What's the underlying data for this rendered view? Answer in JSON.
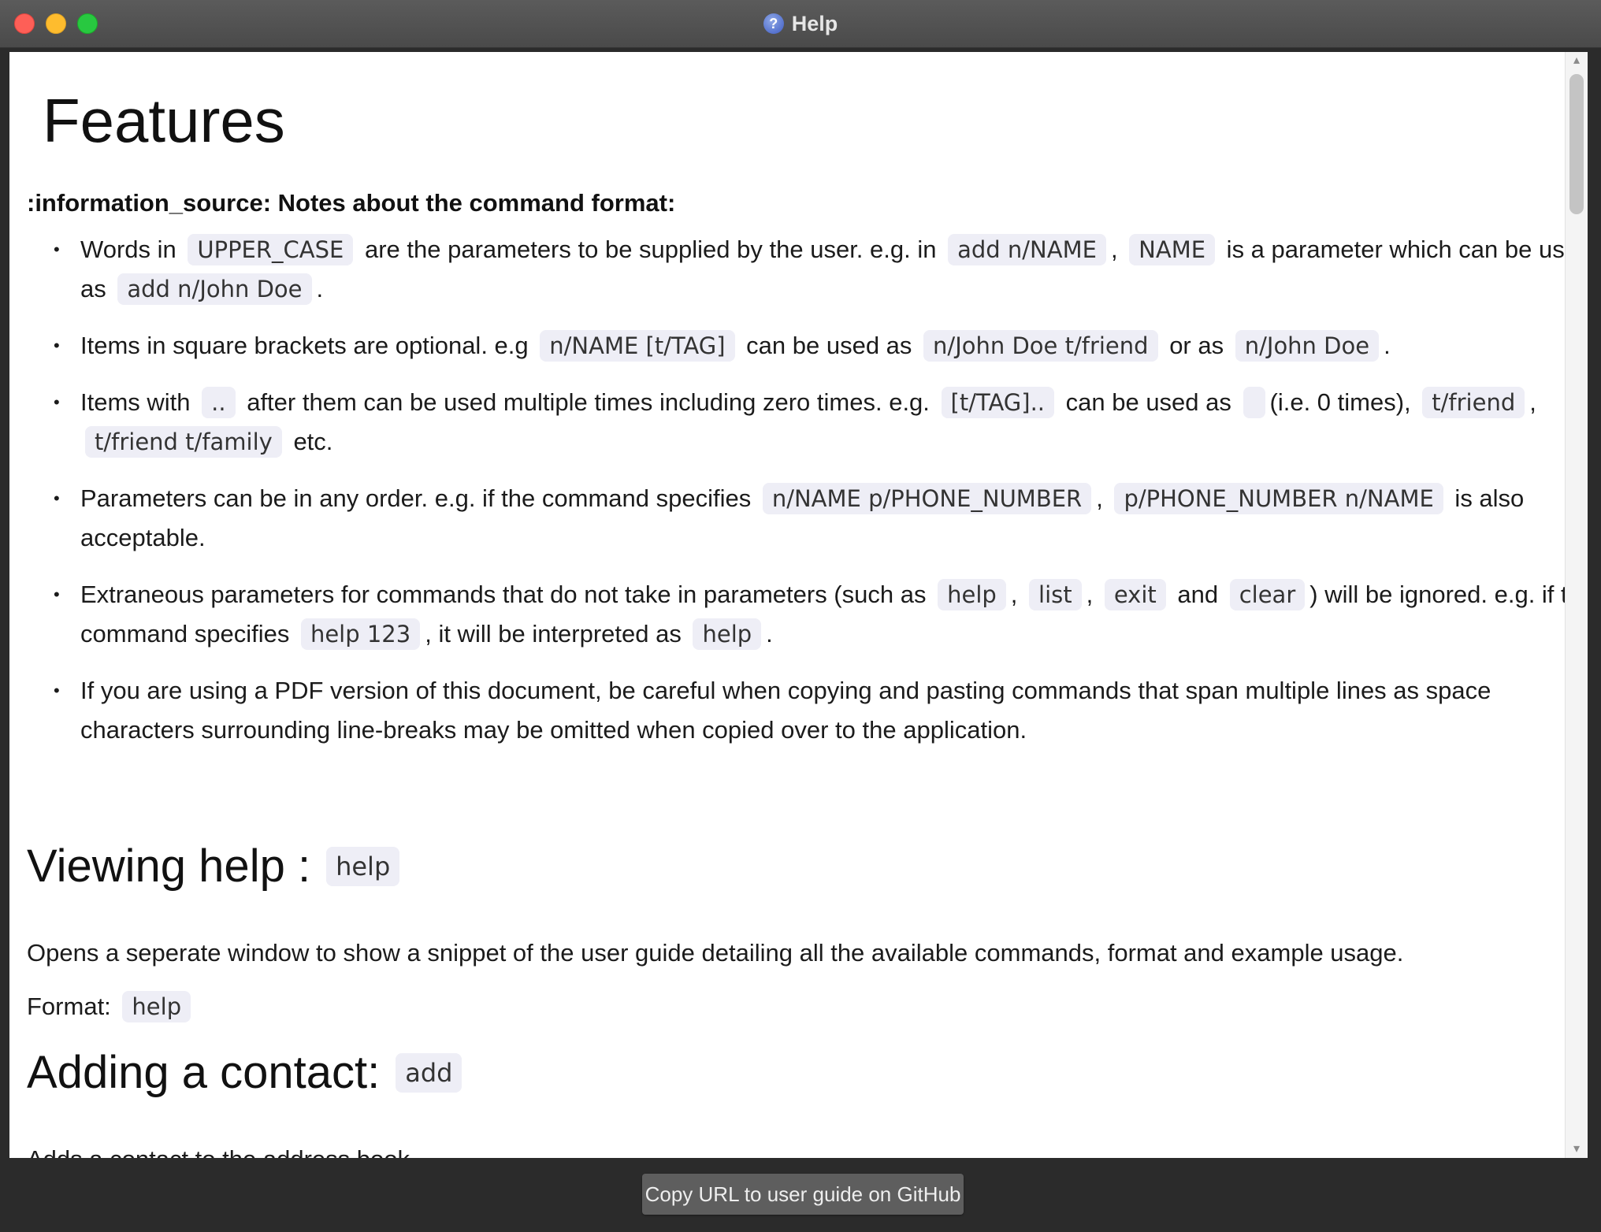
{
  "window": {
    "title": "Help",
    "icon": "help-question-icon"
  },
  "heading": "Features",
  "notes_title": ":information_source: Notes about the command format:",
  "notes": [
    {
      "p1": "Words in ",
      "c1": "UPPER_CASE",
      "p2": " are the parameters to be supplied by the user. e.g. in ",
      "c2": "add n/NAME",
      "p3": ", ",
      "c3": "NAME",
      "p4": " is a parameter which can be used as ",
      "c4": "add n/John Doe",
      "p5": "."
    },
    {
      "p1": "Items in square brackets are optional. e.g ",
      "c1": "n/NAME [t/TAG]",
      "p2": " can be used as ",
      "c2": "n/John Doe t/friend",
      "p3": " or as ",
      "c3": "n/John Doe",
      "p4": "."
    },
    {
      "p1": "Items with ",
      "c1": "..",
      "p2": " after them can be used multiple times including zero times. e.g. ",
      "c2": "[t/TAG]..",
      "p3": " can be used as ",
      "c3": " ",
      "p4": " (i.e. 0 times), ",
      "c4": "t/friend",
      "p5": ", ",
      "c5": "t/friend t/family",
      "p6": " etc."
    },
    {
      "p1": "Parameters can be in any order. e.g. if the command specifies ",
      "c1": "n/NAME p/PHONE_NUMBER",
      "p2": ", ",
      "c2": "p/PHONE_NUMBER n/NAME",
      "p3": " is also acceptable."
    },
    {
      "p1": "Extraneous parameters for commands that do not take in parameters (such as ",
      "c1": "help",
      "p2": ", ",
      "c2": "list",
      "p3": ", ",
      "c3": "exit",
      "p4": " and ",
      "c4": "clear",
      "p5": ") will be ignored. e.g. if the command specifies ",
      "c5": "help 123",
      "p6": ", it will be interpreted as ",
      "c6": "help",
      "p7": "."
    },
    {
      "p1": "If you are using a PDF version of this document, be careful when copying and pasting commands that span multiple lines as space characters surrounding line-breaks may be omitted when copied over to the application."
    }
  ],
  "viewing_help": {
    "title": "Viewing help :",
    "code": "help",
    "description": "Opens a seperate window to show a snippet of the user guide detailing all the available commands, format and example usage.",
    "format_label": "Format:",
    "format_code": "help"
  },
  "adding_contact": {
    "title": "Adding a contact:",
    "code": "add",
    "description": "Adds a contact to the address book."
  },
  "footer": {
    "button_label": "Copy URL to user guide on GitHub"
  }
}
